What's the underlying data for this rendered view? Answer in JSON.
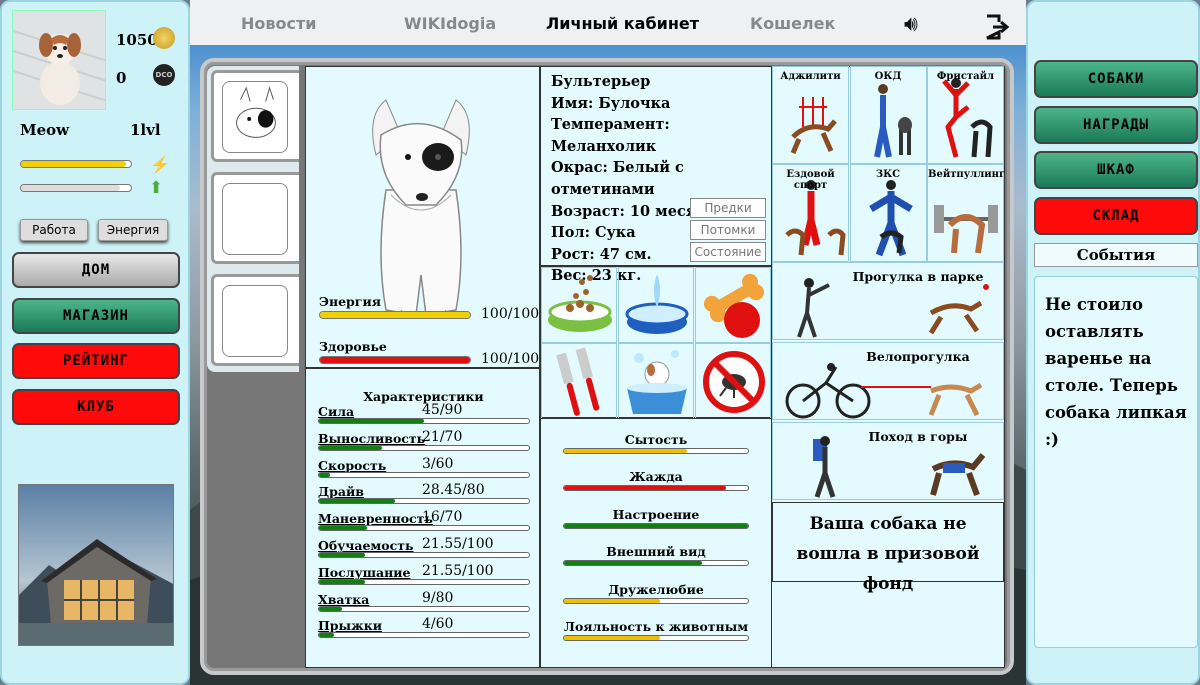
{
  "player": {
    "name": "Meow",
    "level": "1lvl",
    "coins": "1050",
    "dco": "0",
    "coin_label": "DCO"
  },
  "player_bars": {
    "energy_fill": 0.95,
    "xp_fill": 0.9
  },
  "left": {
    "work_label": "Работа",
    "energy_label": "Энергия",
    "menu": [
      {
        "label": "ДОМ",
        "style": "gray"
      },
      {
        "label": "МАГАЗИН",
        "style": "green"
      },
      {
        "label": "РЕЙТИНГ",
        "style": "red"
      },
      {
        "label": "КЛУБ",
        "style": "red"
      }
    ]
  },
  "nav": {
    "items": [
      "Новости",
      "WIKIdogia",
      "Личный кабинет",
      "Кошелек"
    ],
    "active": "Личный кабинет"
  },
  "dog": {
    "breed": "Бультерьер",
    "name": "Имя: Булочка",
    "temperament": "Темперамент: Меланхолик",
    "color": "Окрас: Белый с отметинами",
    "age": "Возраст: 10 месяцев",
    "sex": "Пол: Сука",
    "height": "Рост: 47 см.",
    "weight": "Вес: 23 кг.",
    "buttons": [
      "Предки",
      "Потомки",
      "Состояние"
    ],
    "energy_label": "Энергия",
    "energy_value": "100/100",
    "energy_fill": 1.0,
    "health_label": "Здоровье",
    "health_value": "100/100",
    "health_fill": 1.0
  },
  "characteristics": {
    "title": "Характеристики",
    "items": [
      {
        "label": "Сила",
        "value": "45/90",
        "fill": 0.5
      },
      {
        "label": "Выносливость",
        "value": "21/70",
        "fill": 0.3
      },
      {
        "label": "Скорость",
        "value": "3/60",
        "fill": 0.05
      },
      {
        "label": "Драйв",
        "value": "28.45/80",
        "fill": 0.36
      },
      {
        "label": "Маневренность",
        "value": "16/70",
        "fill": 0.23
      },
      {
        "label": "Обучаемость",
        "value": "21.55/100",
        "fill": 0.22
      },
      {
        "label": "Послушание",
        "value": "21.55/100",
        "fill": 0.22
      },
      {
        "label": "Хватка",
        "value": "9/80",
        "fill": 0.11
      },
      {
        "label": "Прыжки",
        "value": "4/60",
        "fill": 0.07
      }
    ]
  },
  "needs": [
    {
      "label": "Сытость",
      "fill": 0.67,
      "color": "#f0c000"
    },
    {
      "label": "Жажда",
      "fill": 0.88,
      "color": "#e01010"
    },
    {
      "label": "Настроение",
      "fill": 1.0,
      "color": "#108010"
    },
    {
      "label": "Внешний вид",
      "fill": 0.75,
      "color": "#108010"
    },
    {
      "label": "Дружелюбие",
      "fill": 0.52,
      "color": "#f0c000"
    },
    {
      "label": "Лояльность к животным",
      "fill": 0.52,
      "color": "#f0c000"
    }
  ],
  "items": [
    "food-bowl-icon",
    "water-bowl-icon",
    "toys-icon",
    "comb-icon",
    "bath-icon",
    "no-flea-icon"
  ],
  "competitions": [
    "Аджилити",
    "ОКД",
    "Фристайл",
    "Ездовой спорт",
    "ЗКС",
    "Вейтпуллинг"
  ],
  "walks": [
    "Прогулка в парке",
    "Велопрогулка",
    "Поход в горы"
  ],
  "prize_message": "Ваша собака не вошла в призовой фонд",
  "right": {
    "buttons": [
      {
        "label": "СОБАКИ",
        "style": "green"
      },
      {
        "label": "НАГРАДЫ",
        "style": "green"
      },
      {
        "label": "ШКАФ",
        "style": "green"
      },
      {
        "label": "СКЛАД",
        "style": "red"
      }
    ],
    "events_title": "События",
    "event_text": "Не стоило оставлять варенье на столе. Теперь собака липкая :)"
  },
  "colors": {
    "panel": "#cdf2f7",
    "main": "#e3fbff",
    "green_btn": "#2a9a6e",
    "red_btn": "#ff0a0a",
    "energy": "#f0d000",
    "health": "#e01010",
    "char": "#108010"
  }
}
